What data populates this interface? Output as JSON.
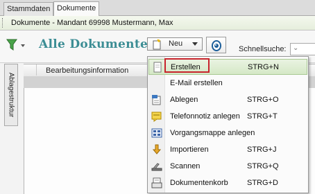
{
  "tabs": [
    {
      "label": "Stammdaten",
      "active": false
    },
    {
      "label": "Dokumente",
      "active": true
    }
  ],
  "breadcrumb": "Dokumente - Mandant 69998 Mustermann, Max",
  "toolbar": {
    "title": "Alle Dokumente",
    "new_button_label": "Neu",
    "quick_search_label": "Schnellsuche:",
    "search_value": ""
  },
  "sidebar_tab": "Ablagestruktur",
  "grid": {
    "columns": [
      "Bearbeitungsinformation"
    ]
  },
  "menu": {
    "items": [
      {
        "label": "Erstellen",
        "shortcut": "STRG+N",
        "icon": "new-document-icon",
        "highlighted": true
      },
      {
        "label": "E-Mail erstellen",
        "shortcut": "",
        "icon": "",
        "highlighted": false
      },
      {
        "label": "Ablegen",
        "shortcut": "STRG+O",
        "icon": "file-document-icon",
        "highlighted": false
      },
      {
        "label": "Telefonnotiz anlegen",
        "shortcut": "STRG+T",
        "icon": "phone-note-icon",
        "highlighted": false
      },
      {
        "label": "Vorgangsmappe anlegen",
        "shortcut": "",
        "icon": "folder-grid-icon",
        "highlighted": false
      },
      {
        "label": "Importieren",
        "shortcut": "STRG+J",
        "icon": "import-arrow-icon",
        "highlighted": false
      },
      {
        "label": "Scannen",
        "shortcut": "STRG+Q",
        "icon": "scanner-icon",
        "highlighted": false
      },
      {
        "label": "Dokumentenkorb",
        "shortcut": "STRG+D",
        "icon": "document-basket-icon",
        "highlighted": false
      }
    ]
  },
  "colors": {
    "title": "#3c8d94",
    "highlight_border": "#c8232c",
    "highlight_fill": "#d5e8c6"
  }
}
